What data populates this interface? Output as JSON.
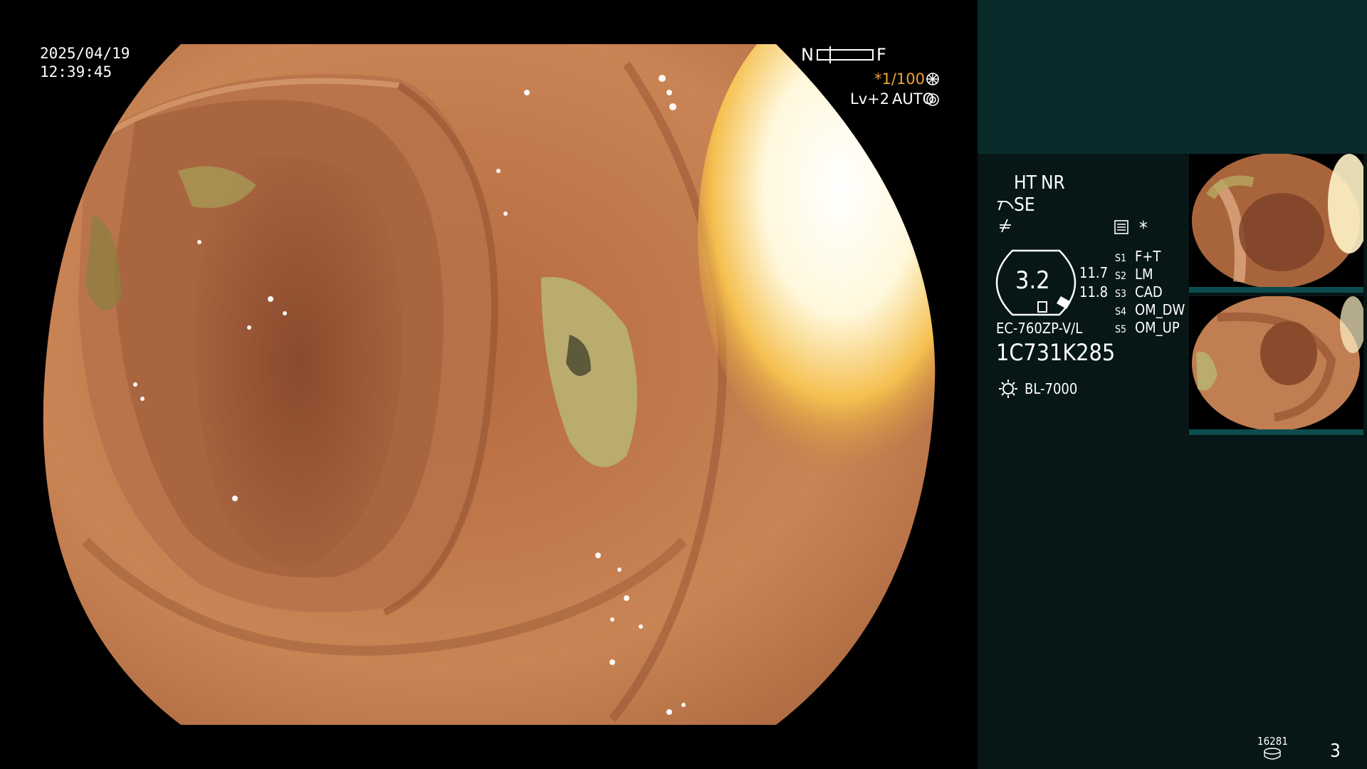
{
  "overlay": {
    "date": "2025/04/19",
    "time": "12:39:45",
    "nf_near": "N",
    "nf_far": "F",
    "shutter": "*1/100",
    "level": "Lv+2",
    "mode": "AUTO"
  },
  "panel": {
    "ht": "HT",
    "nr": "NR",
    "se": "SE",
    "zoom_value": "3.2",
    "val_top": "11.7",
    "val_bottom": "11.8",
    "asterisk": "*",
    "scope_model": "EC-760ZP-V/L",
    "serial": "1C731K285",
    "light_source": "BL-7000",
    "switches": [
      {
        "key": "S1",
        "value": "F+T"
      },
      {
        "key": "S2",
        "value": "LM"
      },
      {
        "key": "S3",
        "value": "CAD"
      },
      {
        "key": "S4",
        "value": "OM_DW"
      },
      {
        "key": "S5",
        "value": "OM_UP"
      }
    ],
    "storage_count": "16281",
    "image_count": "3"
  },
  "colors": {
    "accent_orange": "#f0a23a",
    "panel_top": "#0b2a2b",
    "panel_body": "#071616",
    "thumb_bar": "#0d4c4c"
  },
  "icons": [
    "dial-icon",
    "ring-icon",
    "scope-se-icon",
    "freeze-icon",
    "menu-card-icon",
    "light-bulb-icon",
    "storage-disk-icon"
  ]
}
